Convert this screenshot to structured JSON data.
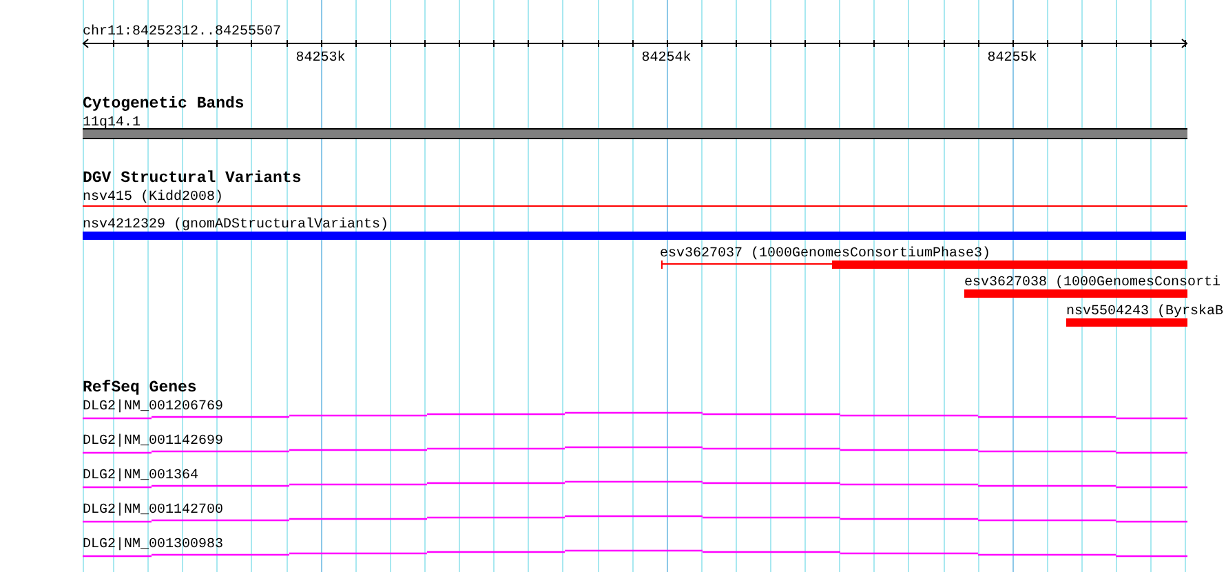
{
  "ruler": {
    "label": "chr11:84252312..84255507",
    "ticks": [
      "84253k",
      "84254k",
      "84255k"
    ]
  },
  "tracks": [
    {
      "title": "Cytogenetic Bands",
      "features": [
        {
          "label": "11q14.1",
          "kind": "band",
          "color": "#808080"
        }
      ]
    },
    {
      "title": "DGV Structural Variants",
      "features": [
        {
          "label": "nsv415 (Kidd2008)",
          "kind": "line",
          "color": "#ff0000"
        },
        {
          "label": "nsv4212329 (gnomADStructuralVariants)",
          "kind": "bar",
          "color": "#0000ff"
        },
        {
          "label": "esv3627037 (1000GenomesConsortiumPhase3)",
          "kind": "split",
          "color": "#ff0000"
        },
        {
          "label": "esv3627038 (1000GenomesConsorti",
          "kind": "bar",
          "color": "#ff0000"
        },
        {
          "label": "nsv5504243 (ByrskaB",
          "kind": "bar",
          "color": "#ff0000"
        }
      ]
    },
    {
      "title": "RefSeq Genes",
      "features": [
        {
          "label": "DLG2|NM_001206769",
          "kind": "transcript",
          "color": "#ff00ff"
        },
        {
          "label": "DLG2|NM_001142699",
          "kind": "transcript",
          "color": "#ff00ff"
        },
        {
          "label": "DLG2|NM_001364",
          "kind": "transcript",
          "color": "#ff00ff"
        },
        {
          "label": "DLG2|NM_001142700",
          "kind": "transcript",
          "color": "#ff00ff"
        },
        {
          "label": "DLG2|NM_001300983",
          "kind": "transcript",
          "color": "#ff00ff"
        }
      ]
    }
  ]
}
